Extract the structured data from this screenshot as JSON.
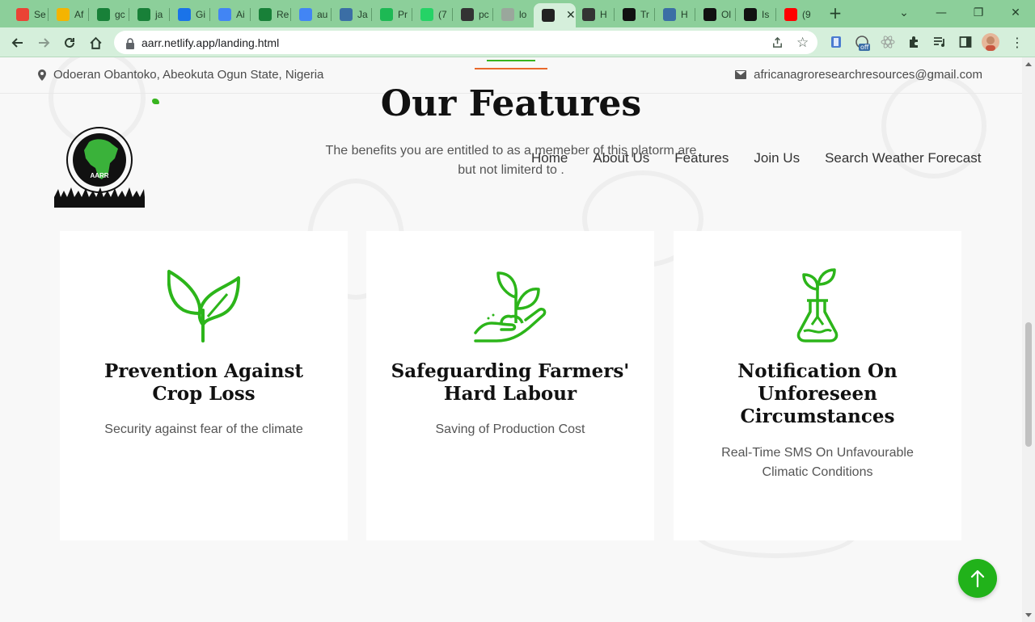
{
  "browser": {
    "tabs": [
      {
        "title": "Se",
        "icon": "gmail-icon",
        "color": "#ea4335"
      },
      {
        "title": "Af",
        "icon": "slides-icon",
        "color": "#f4b400"
      },
      {
        "title": "gc",
        "icon": "plus-cross-icon",
        "color": "#188038"
      },
      {
        "title": "ja",
        "icon": "plus-cross-icon",
        "color": "#188038"
      },
      {
        "title": "Gi",
        "icon": "person-icon",
        "color": "#1a73e8"
      },
      {
        "title": "Ai",
        "icon": "google-icon",
        "color": "#4285f4"
      },
      {
        "title": "Re",
        "icon": "plus-cross-icon",
        "color": "#188038"
      },
      {
        "title": "au",
        "icon": "google-icon",
        "color": "#4285f4"
      },
      {
        "title": "Ja",
        "icon": "globe-icon",
        "color": "#3b6ea5"
      },
      {
        "title": "Pr",
        "icon": "gem-icon",
        "color": "#1db954"
      },
      {
        "title": "(7",
        "icon": "whatsapp-icon",
        "color": "#25d366"
      },
      {
        "title": "pc",
        "icon": "globe-icon",
        "color": "#333333"
      },
      {
        "title": "lo",
        "icon": "globe-icon",
        "color": "#9aa79c"
      },
      {
        "title": "",
        "icon": "site-logo-icon",
        "color": "#222222"
      },
      {
        "title": "H",
        "icon": "history-icon",
        "color": "#333333"
      },
      {
        "title": "Tr",
        "icon": "github-icon",
        "color": "#111111"
      },
      {
        "title": "H",
        "icon": "globe-icon",
        "color": "#3b6ea5"
      },
      {
        "title": "Ol",
        "icon": "github-icon",
        "color": "#111111"
      },
      {
        "title": "Is",
        "icon": "github-icon",
        "color": "#111111"
      },
      {
        "title": "(9",
        "icon": "youtube-icon",
        "color": "#ff0000"
      }
    ],
    "new_tab_label": "+",
    "url": "aarr.netlify.app/landing.html",
    "extension_badge": "off"
  },
  "topbar": {
    "address": "Odoeran Obantoko, Abeokuta Ogun State, Nigeria",
    "email": "africanagroresearchresources@gmail.com"
  },
  "logo": {
    "text": "AARR",
    "ring_text": "AFRICAN AGRICULTURAL RESEARCH RESOURCES"
  },
  "nav": {
    "items": [
      "Home",
      "About Us",
      "Features",
      "Join Us",
      "Search Weather Forecast"
    ]
  },
  "section": {
    "title": "Our Features",
    "subtitle_line1": "The benefits you are entitled to as a memeber of this platorm are",
    "subtitle_line2": "but not limiterd to ."
  },
  "cards": [
    {
      "title_line1": "Prevention Against",
      "title_line2": "Crop Loss",
      "title_line3": "",
      "text_line1": "Security against fear of the climate",
      "text_line2": "",
      "icon": "sprout-icon"
    },
    {
      "title_line1": "Safeguarding Farmers'",
      "title_line2": "Hard Labour",
      "title_line3": "",
      "text_line1": "Saving of Production Cost",
      "text_line2": "",
      "icon": "hand-plant-icon"
    },
    {
      "title_line1": "Notification On",
      "title_line2": "Unforeseen",
      "title_line3": "Circumstances",
      "text_line1": "Real-Time SMS On Unfavourable",
      "text_line2": "Climatic Conditions",
      "icon": "flask-plant-icon"
    }
  ],
  "colors": {
    "accent_green": "#38b41f",
    "accent_orange": "#e8692b",
    "back_to_top": "#21b21a"
  }
}
